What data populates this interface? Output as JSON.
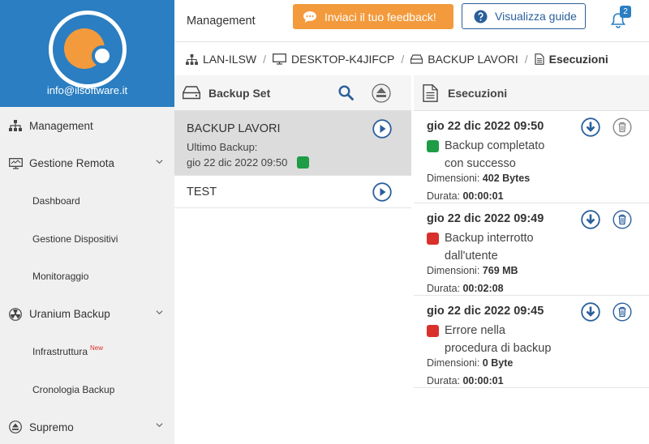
{
  "sidebar": {
    "email": "info@ilsoftware.it",
    "items": [
      {
        "label": "Management",
        "icon": "sitemap-icon"
      },
      {
        "label": "Gestione Remota",
        "icon": "monitor-icon"
      },
      {
        "label": "Dashboard"
      },
      {
        "label": "Gestione Dispositivi"
      },
      {
        "label": "Monitoraggio"
      },
      {
        "label": "Uranium Backup",
        "icon": "radiation-icon"
      },
      {
        "label": "Infrastruttura",
        "badge": "New"
      },
      {
        "label": "Cronologia Backup"
      },
      {
        "label": "Supremo",
        "icon": "supremo-icon"
      }
    ]
  },
  "topbar": {
    "title": "Management",
    "feedback_label": "Inviaci il tuo feedback!",
    "guide_label": "Visualizza guide",
    "notifications_count": "2"
  },
  "breadcrumb": {
    "items": [
      "LAN-ILSW",
      "DESKTOP-K4JIFCP",
      "BACKUP LAVORI",
      "Esecuzioni"
    ]
  },
  "backup_set": {
    "header": "Backup Set",
    "items": [
      {
        "name": "BACKUP LAVORI",
        "last_label": "Ultimo Backup:",
        "last_date": "gio 22 dic 2022 09:50",
        "status_color": "#1e9c46"
      },
      {
        "name": "TEST"
      }
    ]
  },
  "executions": {
    "header": "Esecuzioni",
    "dim_label": "Dimensioni:",
    "dur_label": "Durata:",
    "items": [
      {
        "date": "gio 22 dic 2022 09:50",
        "status_color": "green",
        "status_line1": "Backup completato",
        "status_line2": "con successo",
        "size": "402 Bytes",
        "duration": "00:00:01"
      },
      {
        "date": "gio 22 dic 2022 09:49",
        "status_color": "red",
        "status_line1": "Backup interrotto",
        "status_line2": "dall'utente",
        "size": "769 MB",
        "duration": "00:02:08"
      },
      {
        "date": "gio 22 dic 2022 09:45",
        "status_color": "red",
        "status_line1": "Errore nella",
        "status_line2": "procedura di backup",
        "size": "0 Byte",
        "duration": "00:00:01"
      }
    ]
  },
  "colors": {
    "accent": "#2a7ec1",
    "orange": "#f39a3c",
    "success": "#1e9c46",
    "error": "#d9302c"
  }
}
